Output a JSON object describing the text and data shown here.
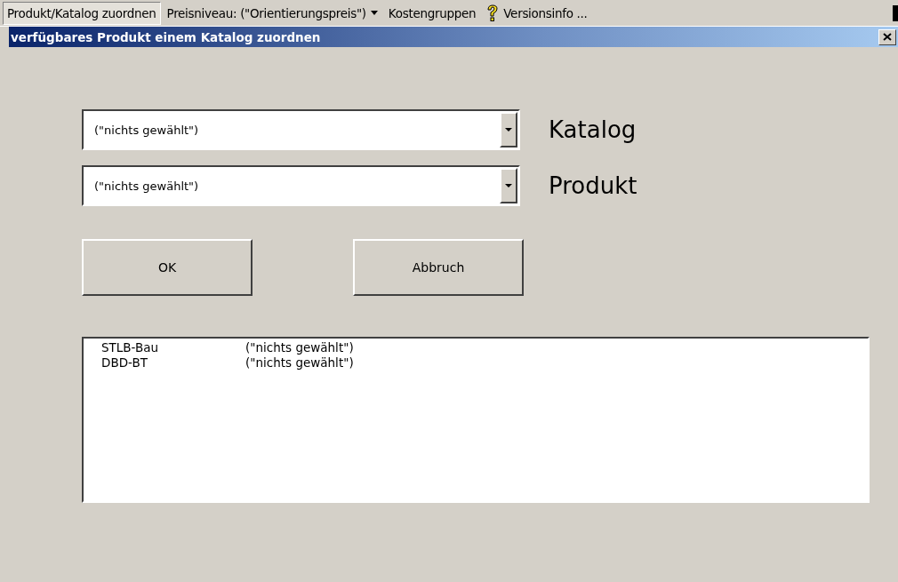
{
  "menu_bar": [
    {
      "label": "Produkt/Katalog zuordnen",
      "kind": "text",
      "selected": true
    },
    {
      "label": "Preisniveau: (\"Orientierungspreis\")",
      "kind": "dropdown",
      "selected": false
    },
    {
      "label": "Kostengruppen",
      "kind": "text",
      "selected": false
    },
    {
      "label": "Versionsinfo ...",
      "kind": "help",
      "selected": false
    }
  ],
  "dialog": {
    "title": "verfügbares Produkt einem Katalog zuordnen",
    "combos": [
      {
        "value": "(\"nichts gewählt\")",
        "label": "Katalog"
      },
      {
        "value": "(\"nichts gewählt\")",
        "label": "Produkt"
      }
    ],
    "buttons": [
      "OK",
      "Abbruch"
    ],
    "list": [
      {
        "column_1": "STLB-Bau",
        "column_2": "(\"nichts gewählt\")"
      },
      {
        "column_1": "DBD-BT",
        "column_2": "(\"nichts gewählt\")"
      }
    ]
  }
}
